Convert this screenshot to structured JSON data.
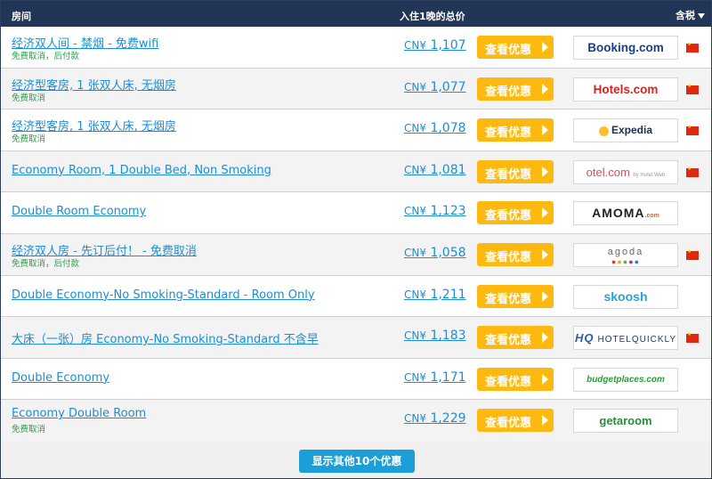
{
  "header": {
    "room_col": "房间",
    "price_col": "入住1晚的总价",
    "tax_toggle": "含税"
  },
  "currency": "CN¥",
  "deal_button_label": "查看优惠",
  "rows": [
    {
      "room": "经济双人间 - 禁烟 - 免费wifi",
      "note": "免费取消，后付款",
      "price": "1,107",
      "provider": "Booking.com",
      "flag": true
    },
    {
      "room": "经济型客房, 1 张双人床, 无烟房",
      "note": "免费取消",
      "price": "1,077",
      "provider": "Hotels.com",
      "flag": true
    },
    {
      "room": "经济型客房, 1 张双人床, 无烟房",
      "note": "免费取消",
      "price": "1,078",
      "provider": "Expedia",
      "flag": true
    },
    {
      "room": "Economy Room, 1 Double Bed, Non Smoking",
      "note": "",
      "price": "1,081",
      "provider": "otel.com",
      "provider_sub": "by Hotel.Web",
      "flag": true
    },
    {
      "room": "Double Room Economy",
      "note": "",
      "price": "1,123",
      "provider": "AMOMA",
      "provider_sub": ".com",
      "flag": false
    },
    {
      "room": "经济双人房 - 先订后付！ - 免费取消",
      "note": "免费取消，后付款",
      "price": "1,058",
      "provider": "agoda",
      "flag": true
    },
    {
      "room": "Double Economy-No Smoking-Standard - Room Only",
      "note": "",
      "price": "1,211",
      "provider": "skoosh",
      "flag": false
    },
    {
      "room": "大床（一张）房 Economy-No Smoking-Standard 不含早",
      "note": "",
      "price": "1,183",
      "provider": "HOTELQUICKLY",
      "provider_mark": "HQ",
      "flag": true
    },
    {
      "room": "Double Economy",
      "note": "",
      "price": "1,171",
      "provider": "budgetplaces.com",
      "flag": false
    },
    {
      "room": "Economy Double Room",
      "note": "免费取消",
      "price": "1,229",
      "provider": "getaroom",
      "flag": false
    }
  ],
  "more_button": "显示其他10个优惠",
  "colors": {
    "header_bg": "#213556",
    "link": "#1a8ed8",
    "note": "#2aa14b",
    "deal_button": "#fdb90f",
    "more_button": "#1c9ed8"
  }
}
